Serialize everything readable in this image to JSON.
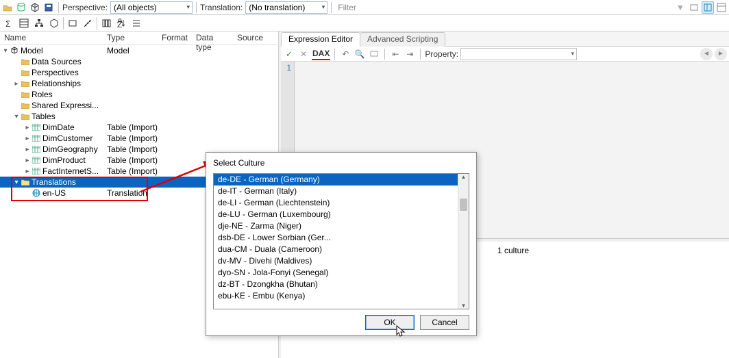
{
  "toolbar": {
    "perspective_label": "Perspective:",
    "perspective_value": "(All objects)",
    "translation_label": "Translation:",
    "translation_value": "(No translation)",
    "filter_placeholder": "Filter"
  },
  "tree": {
    "headers": {
      "name": "Name",
      "type": "Type",
      "format": "Format",
      "datatype": "Data type",
      "source": "Source"
    },
    "root": {
      "label": "Model",
      "type": "Model"
    },
    "rootChildren": [
      {
        "label": "Data Sources"
      },
      {
        "label": "Perspectives"
      },
      {
        "label": "Relationships",
        "expandable": true
      },
      {
        "label": "Roles"
      },
      {
        "label": "Shared Expressi..."
      }
    ],
    "tablesNode": {
      "label": "Tables"
    },
    "tables": [
      {
        "label": "DimDate",
        "type": "Table (Import)"
      },
      {
        "label": "DimCustomer",
        "type": "Table (Import)"
      },
      {
        "label": "DimGeography",
        "type": "Table (Import)"
      },
      {
        "label": "DimProduct",
        "type": "Table (Import)"
      },
      {
        "label": "FactInternetS...",
        "type": "Table (Import)"
      }
    ],
    "translationsNode": {
      "label": "Translations"
    },
    "translations": [
      {
        "label": "en-US",
        "type": "Translation"
      }
    ]
  },
  "editor": {
    "tab_expression": "Expression Editor",
    "tab_scripting": "Advanced Scripting",
    "dax_label": "DAX",
    "property_label": "Property:",
    "line1": "1"
  },
  "props": {
    "row1": {
      "name": "",
      "value": "1 culture"
    }
  },
  "dialog": {
    "title": "Select Culture",
    "items": [
      "de-DE - German (Germany)",
      "de-IT - German (Italy)",
      "de-LI - German (Liechtenstein)",
      "de-LU - German (Luxembourg)",
      "dje-NE - Zarma (Niger)",
      "dsb-DE - Lower Sorbian (Ger...",
      "dua-CM - Duala (Cameroon)",
      "dv-MV - Divehi (Maldives)",
      "dyo-SN - Jola-Fonyi (Senegal)",
      "dz-BT - Dzongkha (Bhutan)",
      "ebu-KE - Embu (Kenya)"
    ],
    "ok": "OK",
    "cancel": "Cancel"
  }
}
